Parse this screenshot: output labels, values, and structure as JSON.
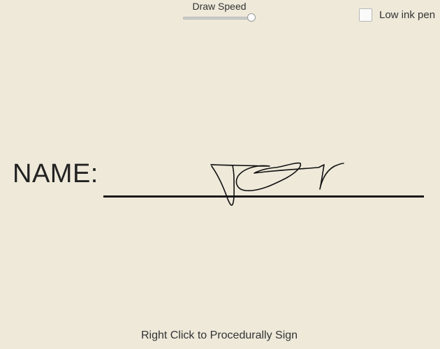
{
  "controls": {
    "draw_speed_label": "Draw Speed",
    "draw_speed_level": 1.0,
    "low_ink_label": "Low ink pen",
    "low_ink_checked": false
  },
  "form": {
    "name_label": "NAME:"
  },
  "hint": "Right Click to Procedurally Sign"
}
